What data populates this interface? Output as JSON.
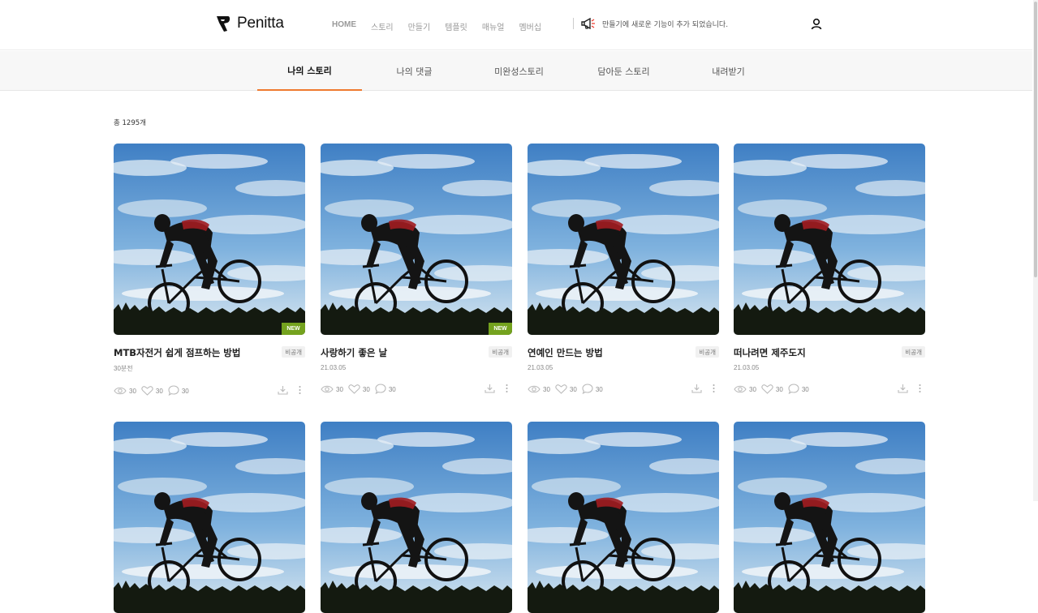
{
  "brand": {
    "name": "Penitta"
  },
  "nav": {
    "items": [
      "HOME",
      "스토리",
      "만들기",
      "템플릿",
      "매뉴얼",
      "멤버십"
    ]
  },
  "notice": {
    "text": "만들기에 새로운 기능이 추가 되었습니다."
  },
  "tabs": [
    "나의 스토리",
    "나의 댓글",
    "미완성스토리",
    "담아둔 스토리",
    "내려받기"
  ],
  "active_tab": "나의 스토리",
  "total_count": "총 1295개",
  "colors": {
    "accent": "#ef7a2f",
    "new_badge": "#74a21e"
  },
  "cards": [
    {
      "title": "MTB자전거 쉽게 점프하는 방법",
      "visibility": "비공개",
      "date": "30분전",
      "new": "NEW",
      "views": "30",
      "likes": "30",
      "comments": "30"
    },
    {
      "title": "사랑하기 좋은 날",
      "visibility": "비공개",
      "date": "21.03.05",
      "new": "NEW",
      "views": "30",
      "likes": "30",
      "comments": "30"
    },
    {
      "title": "연예인 만드는 방법",
      "visibility": "비공개",
      "date": "21.03.05",
      "new": "",
      "views": "30",
      "likes": "30",
      "comments": "30"
    },
    {
      "title": "떠나려면 제주도지",
      "visibility": "비공개",
      "date": "21.03.05",
      "new": "",
      "views": "30",
      "likes": "30",
      "comments": "30"
    }
  ],
  "icons": {
    "logo": "penitta-logo-icon",
    "notice": "megaphone-icon",
    "user": "user-icon",
    "views": "eye-icon",
    "likes": "heart-icon",
    "comments": "comment-icon",
    "download": "download-icon",
    "more": "more-vertical-icon"
  }
}
